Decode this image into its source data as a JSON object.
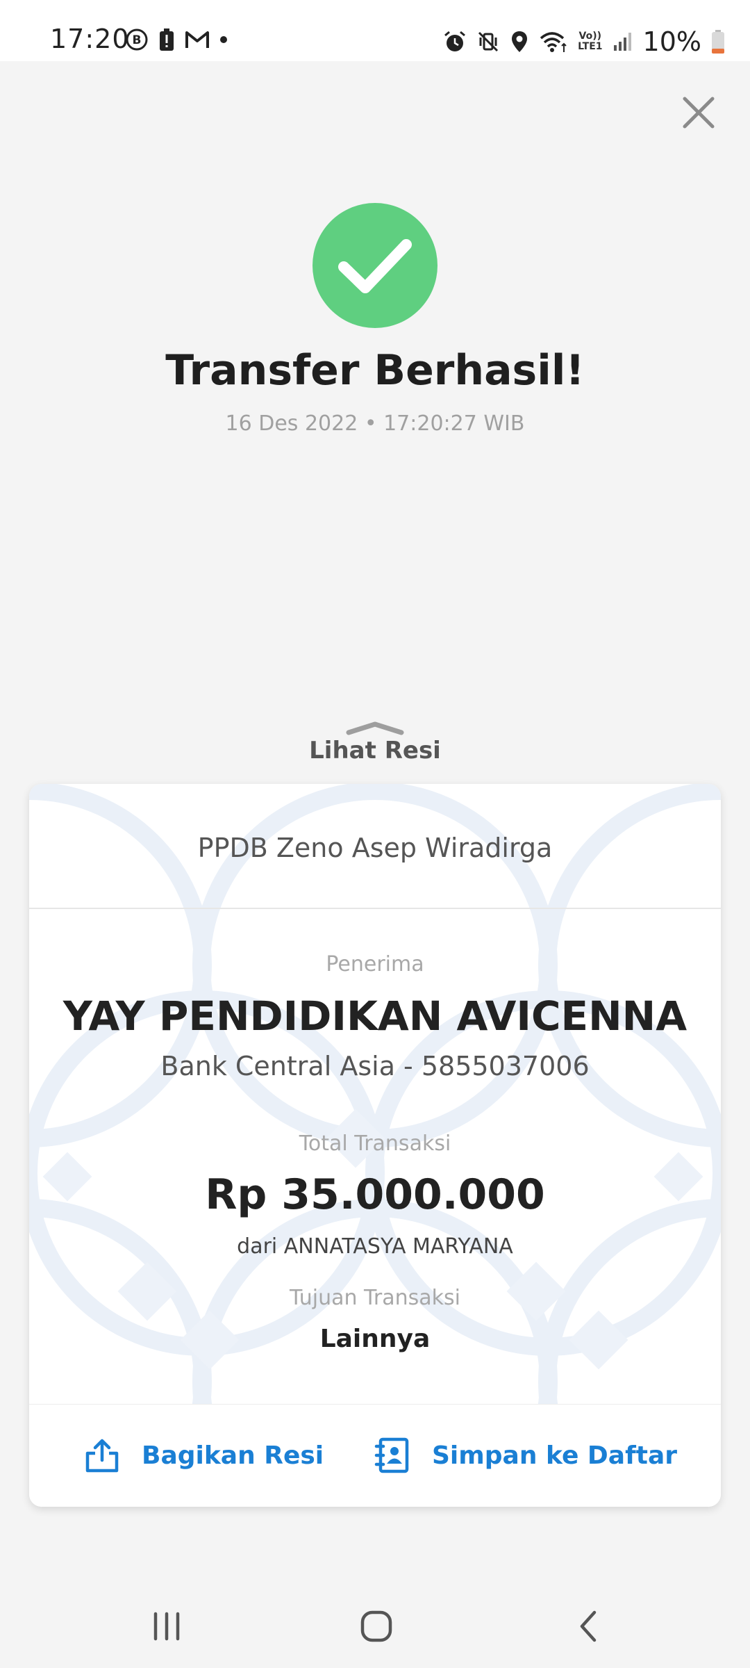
{
  "status_bar": {
    "time": "17:20",
    "battery": "10%",
    "volte_top": "Vo))",
    "volte_bottom": "LTE1",
    "left_icons": [
      "b-circle-icon",
      "battery-alert-icon",
      "gmail-icon",
      "dot-icon"
    ],
    "right_icons": [
      "alarm-icon",
      "vibrate-icon",
      "location-icon",
      "wifi-icon",
      "volte-icon",
      "signal-icon",
      "battery-icon"
    ]
  },
  "header": {
    "close_icon": "close-icon",
    "success_icon": "check-circle-icon",
    "title": "Transfer Berhasil!",
    "datetime": "16 Des 2022 • 17:20:27 WIB"
  },
  "receipt_toggle": {
    "label": "Lihat Resi",
    "icon": "chevron-up-icon"
  },
  "receipt": {
    "note": "PPDB Zeno Asep Wiradirga",
    "recipient_label": "Penerima",
    "recipient_name": "YAY PENDIDIKAN AVICENNA",
    "recipient_bank": "Bank Central Asia - 5855037006",
    "total_label": "Total Transaksi",
    "total_amount": "Rp 35.000.000",
    "from": "dari ANNATASYA MARYANA",
    "purpose_label": "Tujuan Transaksi",
    "purpose": "Lainnya"
  },
  "actions": {
    "share_label": "Bagikan Resi",
    "save_label": "Simpan ke Daftar"
  },
  "colors": {
    "success": "#5fcf80",
    "accent": "#1a7fd4",
    "background": "#f4f4f4"
  },
  "nav": {
    "icons": [
      "recent-apps-icon",
      "home-icon",
      "back-icon"
    ]
  }
}
